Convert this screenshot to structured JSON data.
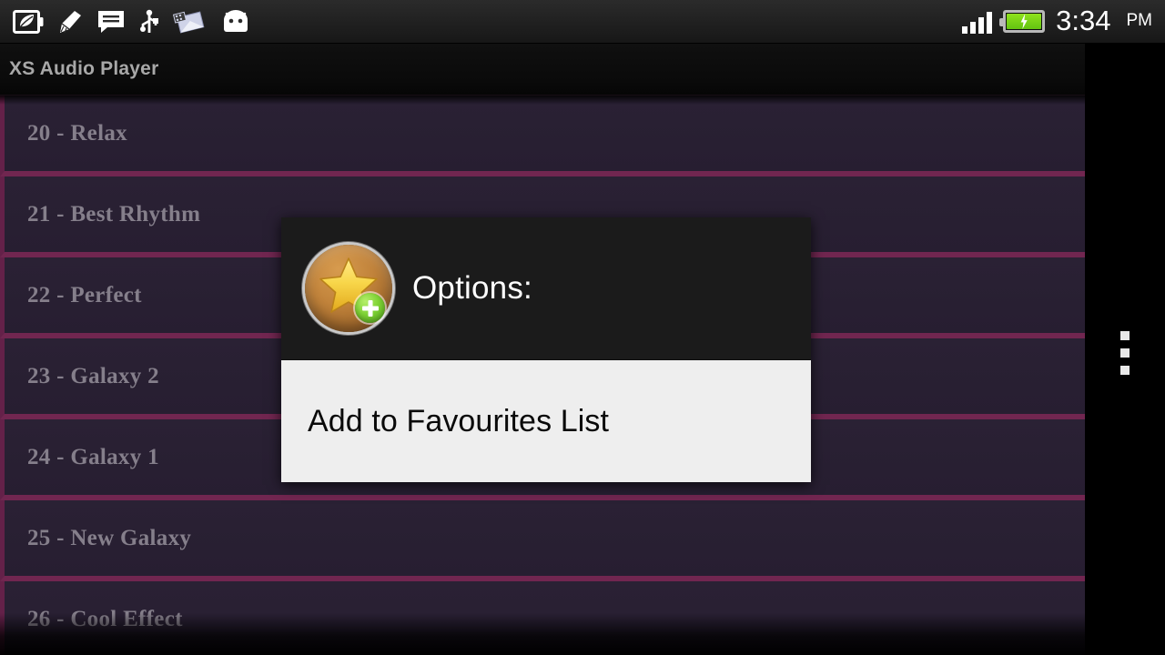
{
  "status_bar": {
    "left_icons": [
      {
        "name": "leaf-battery-saver-icon"
      },
      {
        "name": "broom-cleaner-icon"
      },
      {
        "name": "sms-message-icon"
      },
      {
        "name": "usb-icon"
      },
      {
        "name": "screenshot-gallery-icon"
      },
      {
        "name": "android-icon"
      }
    ],
    "signal_icon": "signal-bars-icon",
    "battery_icon": "battery-charging-icon",
    "time": "3:34",
    "am_pm": "PM"
  },
  "action_bar": {
    "title": "XS Audio Player"
  },
  "list": {
    "items": [
      {
        "label": "20 - Relax"
      },
      {
        "label": "21 - Best Rhythm"
      },
      {
        "label": "22 - Perfect"
      },
      {
        "label": "23 - Galaxy 2"
      },
      {
        "label": "24 - Galaxy 1"
      },
      {
        "label": "25 - New Galaxy"
      },
      {
        "label": "26 - Cool Effect"
      }
    ]
  },
  "dialog": {
    "icon": "star-add-favourite-icon",
    "title": "Options:",
    "options": [
      {
        "label": "Add to Favourites List"
      }
    ]
  },
  "nav_bar": {
    "overflow_icon": "overflow-menu-icon"
  },
  "colors": {
    "row_background": "#2e2439",
    "row_divider": "#7b2a57",
    "row_text": "#918a97",
    "action_bar_text": "#b7b7b7",
    "dialog_header": "#1b1b1b",
    "dialog_body": "#eeeeee",
    "battery_green": "#7ed234",
    "star_gold": "#f5cf3d"
  }
}
